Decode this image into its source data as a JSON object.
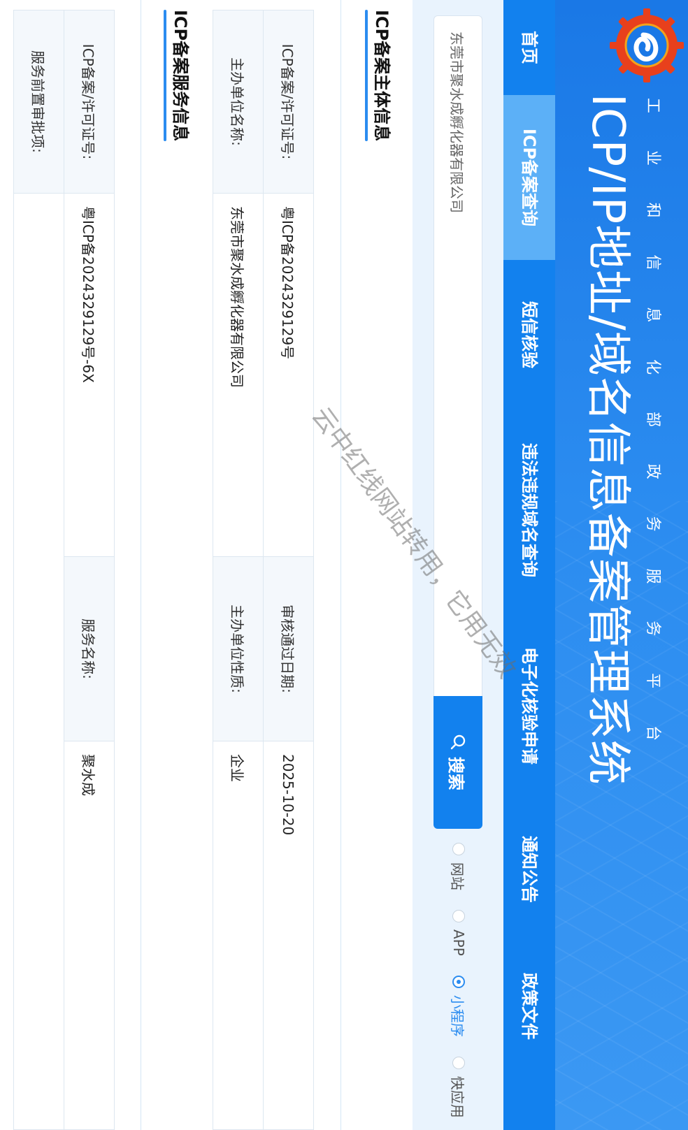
{
  "header": {
    "org_name_chars": [
      "工",
      "业",
      "和",
      "信",
      "息",
      "化",
      "部",
      "政",
      "务",
      "服",
      "务",
      "平",
      "台"
    ],
    "title": "ICP/IP地址/域名信息备案管理系统",
    "brand_colors": {
      "primary": "#1281ee",
      "light": "#2b8cf0",
      "active_nav": "#5cb0f7"
    }
  },
  "nav": {
    "items": [
      {
        "label": "首页"
      },
      {
        "label": "ICP备案查询",
        "active": true
      },
      {
        "label": "短信核验"
      },
      {
        "label": "违法违规域名查询"
      },
      {
        "label": "电子化核验申请"
      },
      {
        "label": "通知公告"
      },
      {
        "label": "政策文件"
      }
    ]
  },
  "search": {
    "value": "东莞市聚水成孵化器有限公司",
    "button_label": "搜索",
    "button_icon": "search-icon",
    "options": [
      {
        "label": "网站",
        "checked": false
      },
      {
        "label": "APP",
        "checked": false
      },
      {
        "label": "小程序",
        "checked": true
      },
      {
        "label": "快应用",
        "checked": false
      }
    ]
  },
  "subject": {
    "title": "ICP备案主体信息",
    "license_label": "ICP备案/许可证号:",
    "license_value": "粤ICP备2024329129号",
    "approval_date_label": "审核通过日期:",
    "approval_date_value": "2025-10-20",
    "org_name_label": "主办单位名称:",
    "org_name_value": "东莞市聚水成孵化器有限公司",
    "org_nature_label": "主办单位性质:",
    "org_nature_value": "企业"
  },
  "service": {
    "title": "ICP备案服务信息",
    "license_label": "ICP备案/许可证号:",
    "license_value": "粤ICP备2024329129号-6X",
    "service_name_label": "服务名称:",
    "service_name_value": "聚水成",
    "pre_approval_label": "服务前置审批项:",
    "pre_approval_value": ""
  },
  "watermark": "云中红线网站转用，它用无效"
}
